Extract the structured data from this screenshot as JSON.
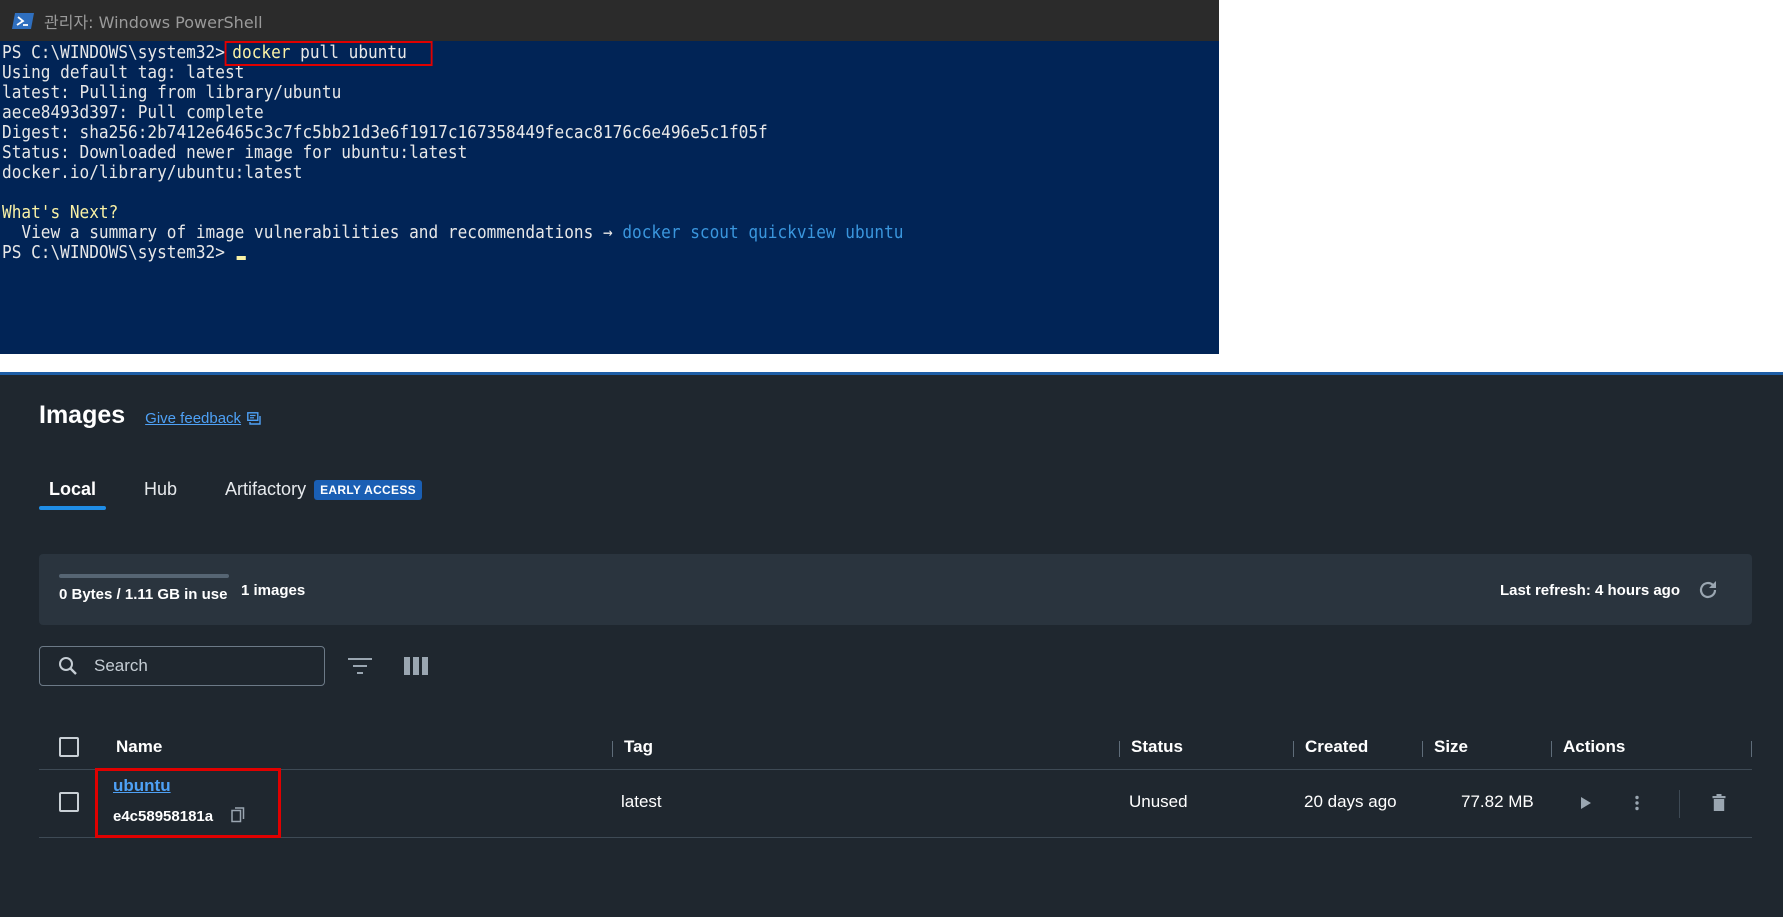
{
  "powershell": {
    "title": "관리자: Windows PowerShell",
    "prompt": "PS C:\\WINDOWS\\system32>",
    "command": "docker pull ubuntu",
    "output": [
      "Using default tag: latest",
      "latest: Pulling from library/ubuntu",
      "aece8493d397: Pull complete",
      "Digest: sha256:2b7412e6465c3c7fc5bb21d3e6f1917c167358449fecac8176c6e496e5c1f05f",
      "Status: Downloaded newer image for ubuntu:latest",
      "docker.io/library/ubuntu:latest"
    ],
    "whats_next": "What's Next?",
    "hint_text": "  View a summary of image vulnerabilities and recommendations → ",
    "hint_command": "docker scout quickview ubuntu",
    "final_prompt": "PS C:\\WINDOWS\\system32> "
  },
  "docker": {
    "title": "Images",
    "feedback_link": "Give feedback",
    "tabs": [
      {
        "label": "Local"
      },
      {
        "label": "Hub"
      },
      {
        "label": "Artifactory"
      }
    ],
    "early_access_badge": "EARLY ACCESS",
    "stats": {
      "usage": "0 Bytes / 1.11 GB in use",
      "usage_fraction": 0.0,
      "images_count": "1 images",
      "last_refresh": "Last refresh: 4 hours ago"
    },
    "search": {
      "placeholder": "Search",
      "value": ""
    },
    "table": {
      "columns": [
        "Name",
        "Tag",
        "Status",
        "Created",
        "Size",
        "Actions"
      ],
      "rows": [
        {
          "name": "ubuntu",
          "id": "e4c58958181a",
          "tag": "latest",
          "status": "Unused",
          "created": "20 days ago",
          "size": "77.82 MB"
        }
      ]
    },
    "icons": {
      "feedback": "chat-icon",
      "refresh": "refresh-icon",
      "search": "search-icon",
      "filter": "filter-icon",
      "columns": "columns-icon",
      "copy": "copy-icon",
      "run": "play-icon",
      "more": "more-vertical-icon",
      "delete": "trash-icon"
    },
    "colors": {
      "background": "#1f272f",
      "accent": "#1f8de6",
      "link": "#4ea1f6",
      "highlight": "#e00000"
    }
  }
}
